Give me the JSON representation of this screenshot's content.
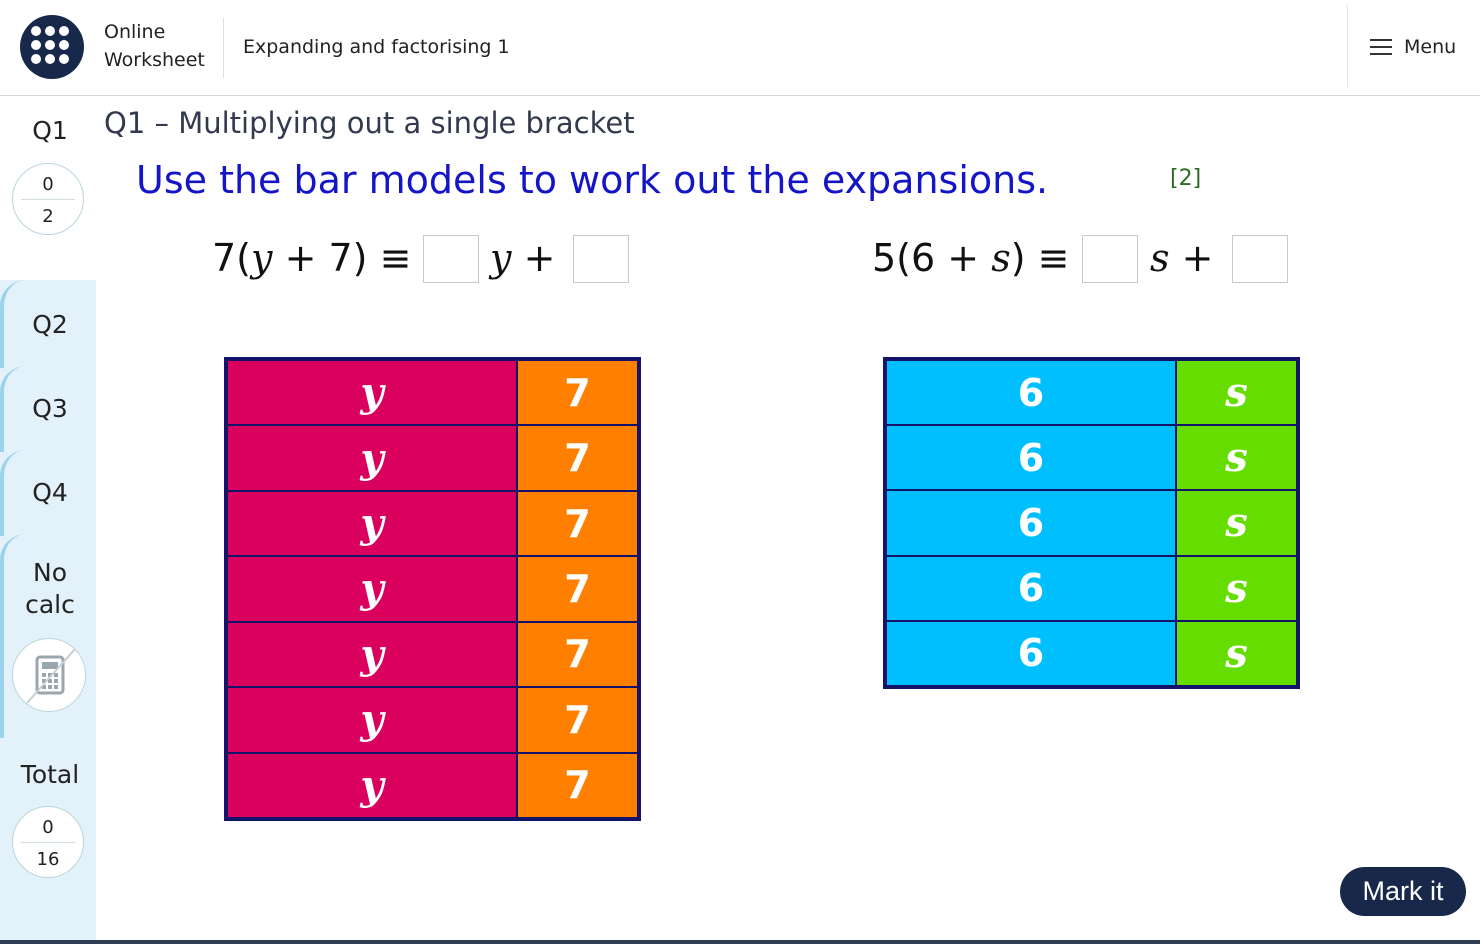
{
  "header": {
    "brand_line1": "Online",
    "brand_line2": "Worksheet",
    "title": "Expanding and factorising 1",
    "menu_label": "Menu"
  },
  "sidebar": {
    "q1": {
      "label": "Q1",
      "score": "0",
      "max": "2"
    },
    "q2": {
      "label": "Q2"
    },
    "q3": {
      "label": "Q3"
    },
    "q4": {
      "label": "Q4"
    },
    "nocalc_line1": "No",
    "nocalc_line2": "calc",
    "total": {
      "label": "Total",
      "score": "0",
      "max": "16"
    }
  },
  "question": {
    "heading": "Q1 – Multiplying out a single bracket",
    "instruction": "Use the bar models to work out the expansions.",
    "marks": "[2]"
  },
  "equations": [
    {
      "lhs_pre": "7(",
      "lhs_var": "y",
      "lhs_post": " + 7) ≡",
      "var": "y",
      "plus": "+",
      "answer1": "",
      "answer2": ""
    },
    {
      "lhs_pre": "5(6 + ",
      "lhs_var": "s",
      "lhs_post": ") ≡",
      "var": "s",
      "plus": "+",
      "answer1": "",
      "answer2": ""
    }
  ],
  "bar_models": [
    {
      "rows": 7,
      "left_label": "y",
      "right_label": "7",
      "left_color": "#d9005e",
      "right_color": "#ff8000"
    },
    {
      "rows": 5,
      "left_label": "6",
      "right_label": "s",
      "left_color": "#00bfff",
      "right_color": "#66dd00"
    }
  ],
  "button": {
    "mark_it": "Mark it"
  },
  "colors": {
    "navy": "#17284a",
    "instruction_blue": "#1515c8",
    "sidebar_bg": "#e3f2fa"
  }
}
